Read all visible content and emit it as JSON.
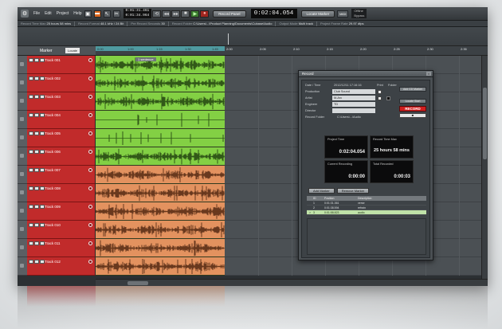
{
  "toolbar": {
    "menu": [
      "File",
      "Edit",
      "Project",
      "Help"
    ],
    "time_small_top": "0:01:31.461",
    "time_small_bottom": "0:01:34.964",
    "record_panel_btn": "Record Panel",
    "main_time": "0:02:04.054",
    "locate_marker_btn": "Locate Marker",
    "midi_label": "MIDI",
    "offline_top": "Offline",
    "offline_bottom": "Bypass"
  },
  "status": {
    "record_time_max_label": "Record Time Max",
    "record_time_max_value": "25 hours 58 mins",
    "record_format_label": "Record Format",
    "record_format_value": "48.1 kHz / 24 Bit",
    "pre_record_label": "Pre Record Seconds",
    "pre_record_value": "30",
    "record_folder_label": "Record Folder",
    "record_folder_value": "C:\\Users\\...\\Product Planning\\Documents\\Cubase\\Audio",
    "output_mode_label": "Output Mode",
    "output_mode_value": "Multi track",
    "frame_rate_label": "Project Frame Rate",
    "frame_rate_value": "29.97 dfps"
  },
  "header": {
    "marker_label": "Marker",
    "locate_btn": "Locate",
    "marker_flag": "1 sentence"
  },
  "ruler": [
    "0:00",
    "1:00",
    "1:15",
    "1:30",
    "1:45",
    "2:00",
    "2:05",
    "2:10",
    "2:15",
    "2:20",
    "2:25",
    "2:30",
    "2:35",
    "2:40"
  ],
  "tracks": [
    {
      "name": "Track 001",
      "color": "green"
    },
    {
      "name": "Track 002",
      "color": "green"
    },
    {
      "name": "Track 003",
      "color": "green"
    },
    {
      "name": "Track 004",
      "color": "green"
    },
    {
      "name": "Track 005",
      "color": "green"
    },
    {
      "name": "Track 006",
      "color": "green"
    },
    {
      "name": "Track 007",
      "color": "orange"
    },
    {
      "name": "Track 008",
      "color": "orange"
    },
    {
      "name": "Track 009",
      "color": "orange"
    },
    {
      "name": "Track 010",
      "color": "orange"
    },
    {
      "name": "Track 011",
      "color": "orange"
    },
    {
      "name": "Track 012",
      "color": "orange"
    }
  ],
  "record_panel": {
    "title": "Record",
    "date_time_label": "Date / Time",
    "date_time_value": "2012/12/11 17:16:16",
    "production_label": "Production",
    "production_value": "Club Sound",
    "artist_label": "Artist",
    "artist_value": "M-Arc",
    "engineer_label": "Engineer",
    "engineer_value": "TD",
    "director_label": "Director",
    "director_value": "",
    "record_folder_label": "Record Folder",
    "record_folder_value": "C:\\Users\\...\\Audio",
    "print_label": "Print",
    "folder_label": "Folder",
    "add_cd_btn": "Add CD Marker",
    "locate_btn": "Locate Start",
    "record_btn": "RECORD",
    "lock_btn": "■",
    "project_time_label": "Project Time",
    "project_time_value": "0:02:04.054",
    "record_time_max_label": "Record Time Max",
    "record_time_max_value": "25 hours 58 mins",
    "current_recording_label": "Current Recording",
    "current_recording_value": "0:00:00",
    "total_recorded_label": "Total Recorded",
    "total_recorded_value": "0:00:03",
    "add_marker_btn": "Add Marker",
    "remove_marker_btn": "Remove Marker",
    "table_headers": [
      "",
      "ID",
      "Position",
      "Description"
    ],
    "markers": [
      {
        "id": "1",
        "position": "0:01:31.361",
        "description": "verse"
      },
      {
        "id": "2",
        "position": "0:01:38.594",
        "description": "refrain"
      },
      {
        "id": "3",
        "position": "0:01:58.823",
        "description": "audio"
      }
    ]
  }
}
